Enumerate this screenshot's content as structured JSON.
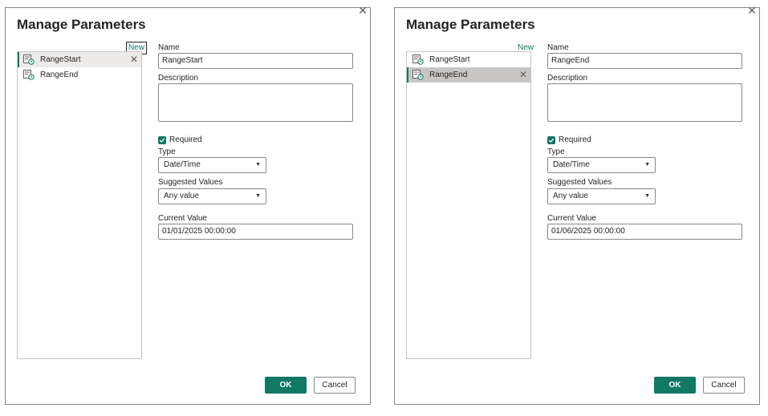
{
  "colors": {
    "accent": "#117865",
    "selected_light": "#edebe9",
    "selected_dark": "#c8c6c4",
    "border": "#8a8886"
  },
  "icons": {
    "close": "close-icon",
    "parameter": "parameter-icon",
    "delete": "delete-icon",
    "checkbox": "checkbox-checked-icon",
    "dropdown": "chevron-down-icon"
  },
  "dialogs": [
    {
      "title": "Manage Parameters",
      "close_label": "✕",
      "new_label": "New",
      "parameters": [
        {
          "label": "RangeStart",
          "selected": true
        },
        {
          "label": "RangeEnd",
          "selected": false
        }
      ],
      "delete_label": "✕",
      "name_label": "Name",
      "name_value": "RangeStart",
      "description_label": "Description",
      "description_value": "",
      "required_label": "Required",
      "required_checked": true,
      "type_label": "Type",
      "type_value": "Date/Time",
      "suggested_label": "Suggested Values",
      "suggested_value": "Any value",
      "current_label": "Current Value",
      "current_value": "01/01/2025 00:00:00",
      "ok_label": "OK",
      "cancel_label": "Cancel"
    },
    {
      "title": "Manage Parameters",
      "close_label": "✕",
      "new_label": "New",
      "parameters": [
        {
          "label": "RangeStart",
          "selected": false
        },
        {
          "label": "RangeEnd",
          "selected": true
        }
      ],
      "delete_label": "✕",
      "name_label": "Name",
      "name_value": "RangeEnd",
      "description_label": "Description",
      "description_value": "",
      "required_label": "Required",
      "required_checked": true,
      "type_label": "Type",
      "type_value": "Date/Time",
      "suggested_label": "Suggested Values",
      "suggested_value": "Any value",
      "current_label": "Current Value",
      "current_value": "01/06/2025 00:00:00",
      "ok_label": "OK",
      "cancel_label": "Cancel"
    }
  ]
}
